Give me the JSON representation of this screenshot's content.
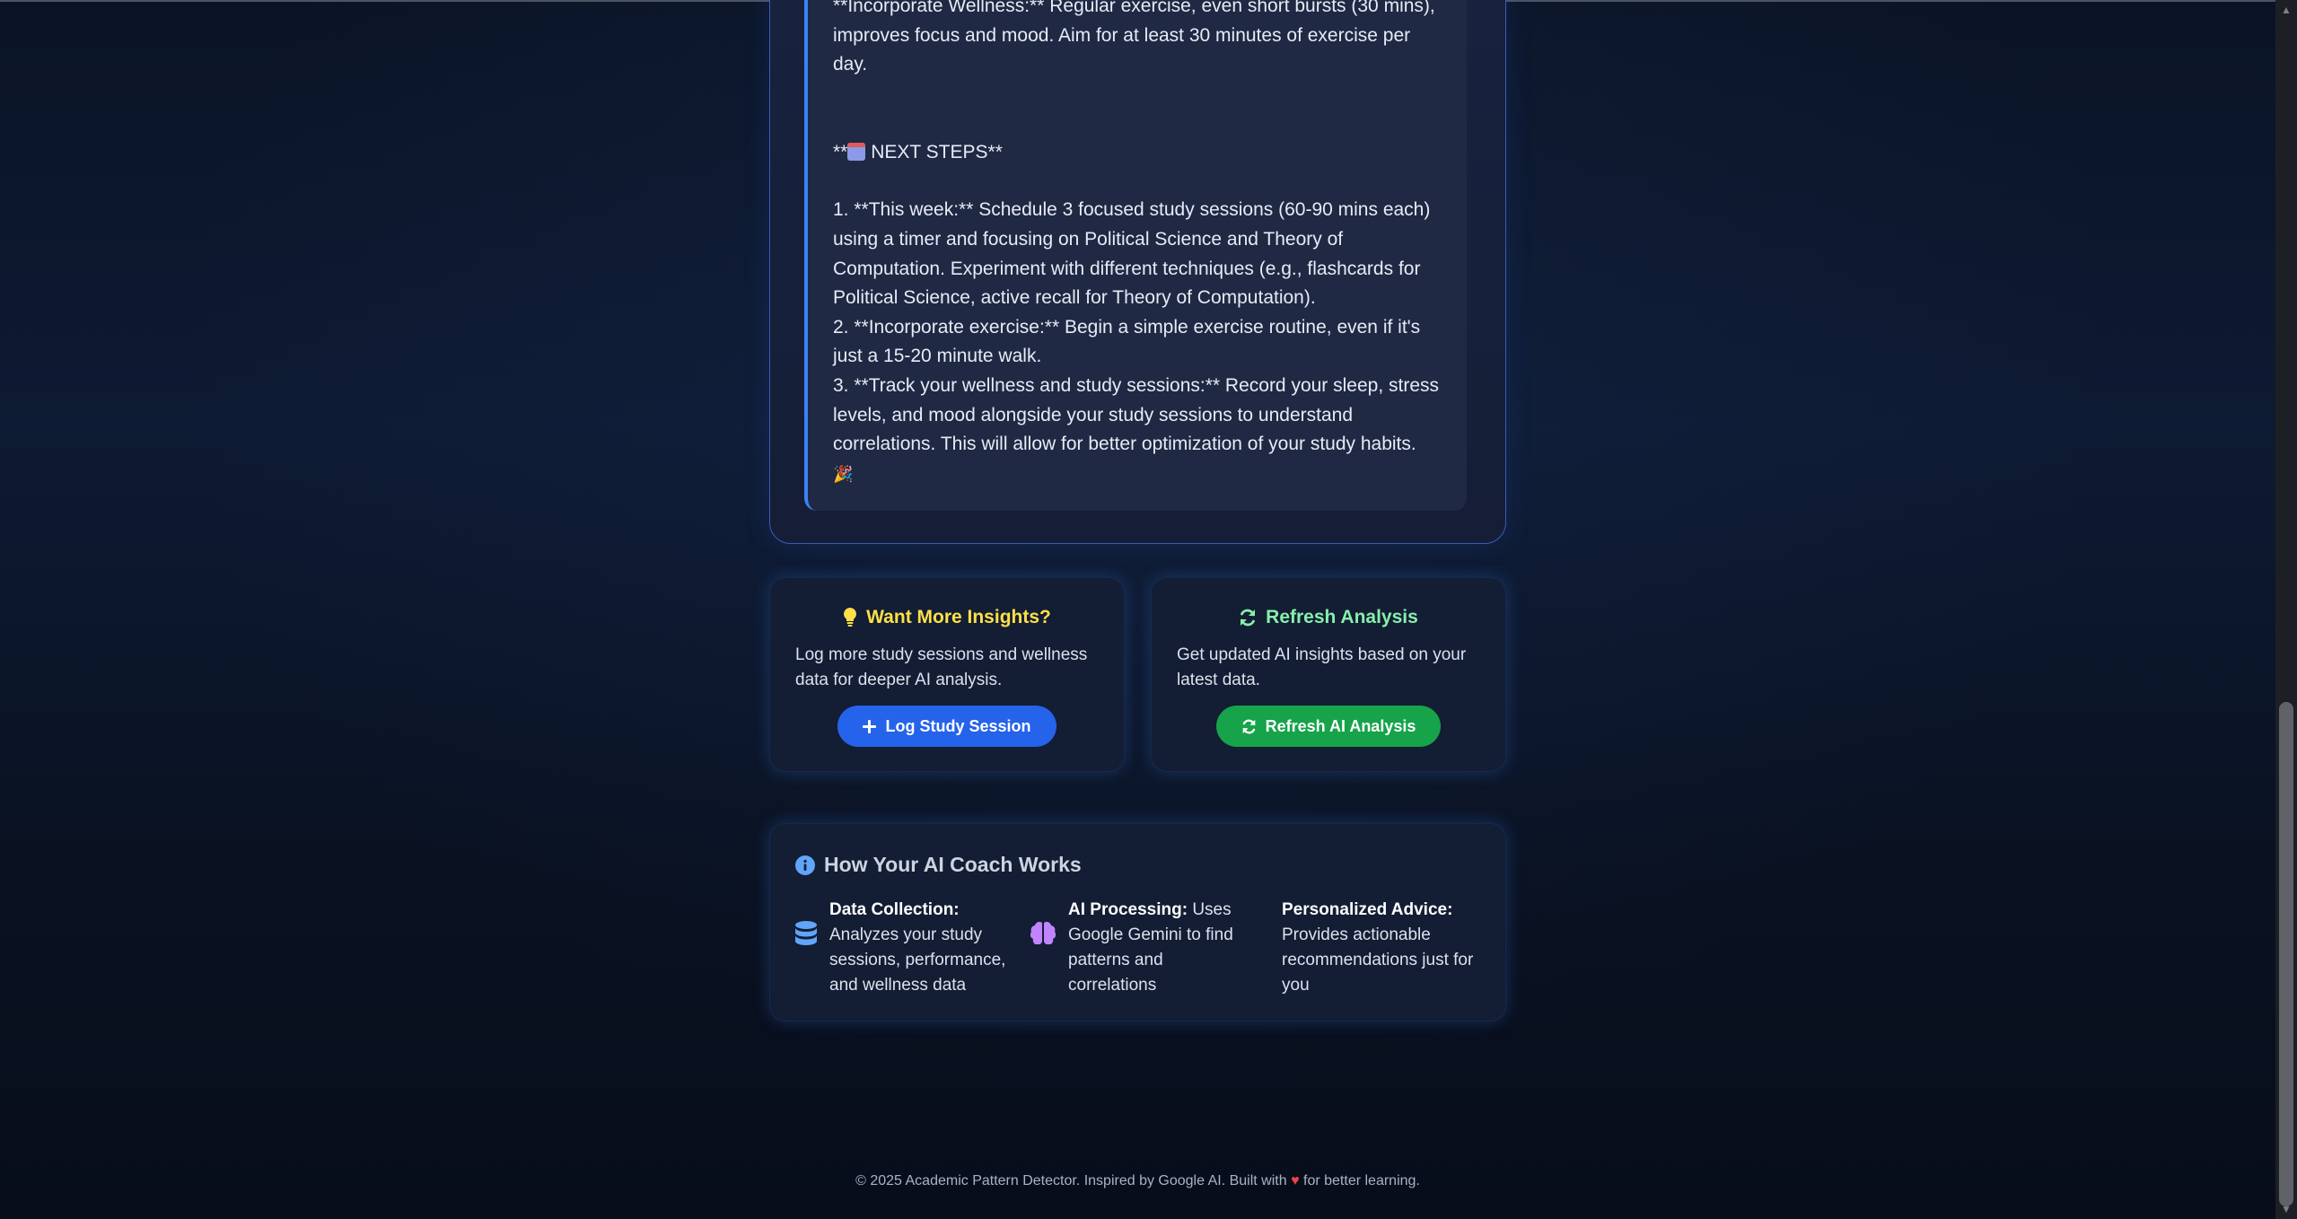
{
  "analysis": {
    "partial_line": "**Incorporate Wellness:** Regular exercise, even short bursts (30 mins), improves focus and mood. Aim for at least 30 minutes of exercise per day.",
    "next_steps_heading": "NEXT STEPS**",
    "next_steps_prefix": "**",
    "step1": "1. **This week:** Schedule 3 focused study sessions (60-90 mins each) using a timer and focusing on Political Science and Theory of Computation. Experiment with different techniques (e.g., flashcards for Political Science, active recall for Theory of Computation).",
    "step2": "2. **Incorporate exercise:** Begin a simple exercise routine, even if it's just a 15-20 minute walk.",
    "step3": "3. **Track your wellness and study sessions:** Record your sleep, stress levels, and mood alongside your study sessions to understand correlations. This will allow for better optimization of your study habits.",
    "end_emoji": "🎉"
  },
  "insights_card": {
    "icon": "lightbulb-icon",
    "title": "Want More Insights?",
    "text": "Log more study sessions and wellness data for deeper AI analysis.",
    "button_label": "Log Study Session"
  },
  "refresh_card": {
    "icon": "refresh-icon",
    "title": "Refresh Analysis",
    "text": "Get updated AI insights based on your latest data.",
    "button_label": "Refresh AI Analysis"
  },
  "how_it_works": {
    "icon": "info-icon",
    "title": "How Your AI Coach Works",
    "items": [
      {
        "icon": "database-icon",
        "label": "Data Collection:",
        "text": "Analyzes your study sessions, performance, and wellness data"
      },
      {
        "icon": "brain-icon",
        "label": "AI Processing:",
        "text": "Uses Google Gemini to find patterns and correlations"
      },
      {
        "label": "Personalized Advice:",
        "text": "Provides actionable recommendations just for you"
      }
    ]
  },
  "footer": {
    "text_before": "© 2025 Academic Pattern Detector. Inspired by Google AI. Built with",
    "text_after": "for better learning."
  },
  "colors": {
    "accent_blue": "#2563eb",
    "accent_green": "#16a34a",
    "title_yellow": "#fde047",
    "title_green": "#86efac",
    "heart": "#ef4444"
  }
}
